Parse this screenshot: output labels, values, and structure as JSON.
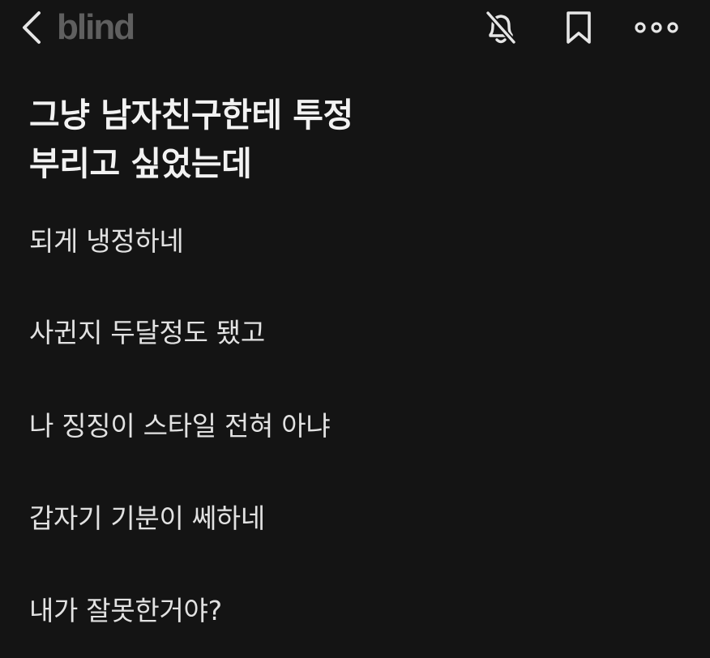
{
  "header": {
    "logo": "blind",
    "icons": {
      "back": "chevron-left-icon",
      "notifications": "bell-off-icon",
      "bookmark": "bookmark-icon",
      "more": "more-horizontal-icon"
    }
  },
  "post": {
    "title": "그냥 남자친구한테 투정\n부리고 싶었는데",
    "lines": [
      "되게 냉정하네",
      "사귄지 두달정도 됐고",
      "나 징징이 스타일 전혀 아냐",
      "갑자기 기분이 쎄하네",
      "내가 잘못한거야?"
    ]
  },
  "colors": {
    "background": "#141414",
    "logo": "#5f5f5f",
    "icon": "#e6e6e6",
    "text": "#e2e2e2"
  }
}
